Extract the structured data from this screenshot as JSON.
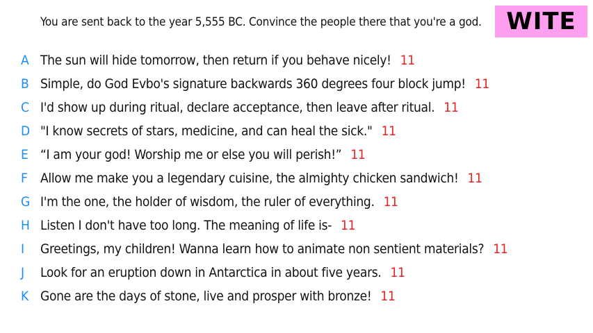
{
  "prompt": "You are sent back to the year 5,555 BC. Convince the people there that you're a god.",
  "title": "WITE",
  "colors": {
    "badge_bg": "#ff9ff0",
    "letter": "#1a8cff",
    "score": "#e82020"
  },
  "answers": [
    {
      "letter": "A",
      "text": "The sun will hide tomorrow, then return if you behave nicely!",
      "score": "11"
    },
    {
      "letter": "B",
      "text": "Simple, do God Evbo's signature backwards 360 degrees four block jump!",
      "score": "11"
    },
    {
      "letter": "C",
      "text": "I'd show up during ritual, declare acceptance, then leave after ritual.",
      "score": "11"
    },
    {
      "letter": "D",
      "text": "\"I know secrets of stars, medicine, and can heal the sick.\"",
      "score": "11"
    },
    {
      "letter": "E",
      "text": "“I am your god! Worship me or else you will perish!”",
      "score": "11"
    },
    {
      "letter": "F",
      "text": "Allow me make you a legendary cuisine, the almighty chicken sandwich!",
      "score": "11"
    },
    {
      "letter": "G",
      "text": "I'm the one, the holder of wisdom, the ruler of everything.",
      "score": "11"
    },
    {
      "letter": "H",
      "text": "Listen I don't have too long. The meaning of life is-",
      "score": "11"
    },
    {
      "letter": "I",
      "text": "Greetings, my children! Wanna learn how to animate non sentient materials?",
      "score": "11"
    },
    {
      "letter": "J",
      "text": "Look for an eruption down in Antarctica in about five years.",
      "score": "11"
    },
    {
      "letter": "K",
      "text": "Gone are the days of stone, live and prosper with bronze!",
      "score": "11"
    }
  ]
}
